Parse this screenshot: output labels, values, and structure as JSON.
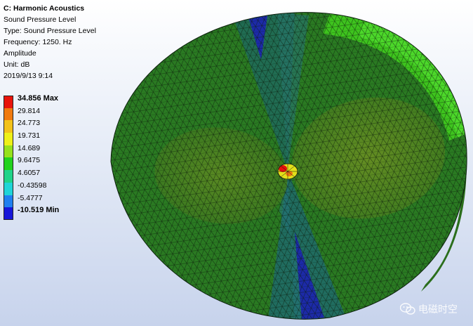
{
  "info": {
    "title": "C: Harmonic Acoustics",
    "lines": [
      "Sound Pressure Level",
      "Type: Sound Pressure Level",
      "Frequency: 1250. Hz",
      "Amplitude",
      "Unit: dB",
      "2019/9/13 9:14"
    ]
  },
  "legend": {
    "entries": [
      {
        "value": "34.856",
        "suffix": "Max",
        "color": "#e8130b",
        "bold": true
      },
      {
        "value": "29.814",
        "suffix": "",
        "color": "#f07a10",
        "bold": false
      },
      {
        "value": "24.773",
        "suffix": "",
        "color": "#f2c21a",
        "bold": false
      },
      {
        "value": "19.731",
        "suffix": "",
        "color": "#eef019",
        "bold": false
      },
      {
        "value": "14.689",
        "suffix": "",
        "color": "#96e11c",
        "bold": false
      },
      {
        "value": "9.6475",
        "suffix": "",
        "color": "#22d21e",
        "bold": false
      },
      {
        "value": "4.6057",
        "suffix": "",
        "color": "#1fd38a",
        "bold": false
      },
      {
        "value": "-0.43598",
        "suffix": "",
        "color": "#1fd4d8",
        "bold": false
      },
      {
        "value": "-5.4777",
        "suffix": "",
        "color": "#1f7ff0",
        "bold": false
      },
      {
        "value": "-10.519",
        "suffix": "Min",
        "color": "#1616d9",
        "bold": true
      }
    ]
  },
  "watermark": {
    "text": "电磁时空",
    "icon": "wechat-icon"
  },
  "model": {
    "icon": "fe-mesh-contour"
  }
}
